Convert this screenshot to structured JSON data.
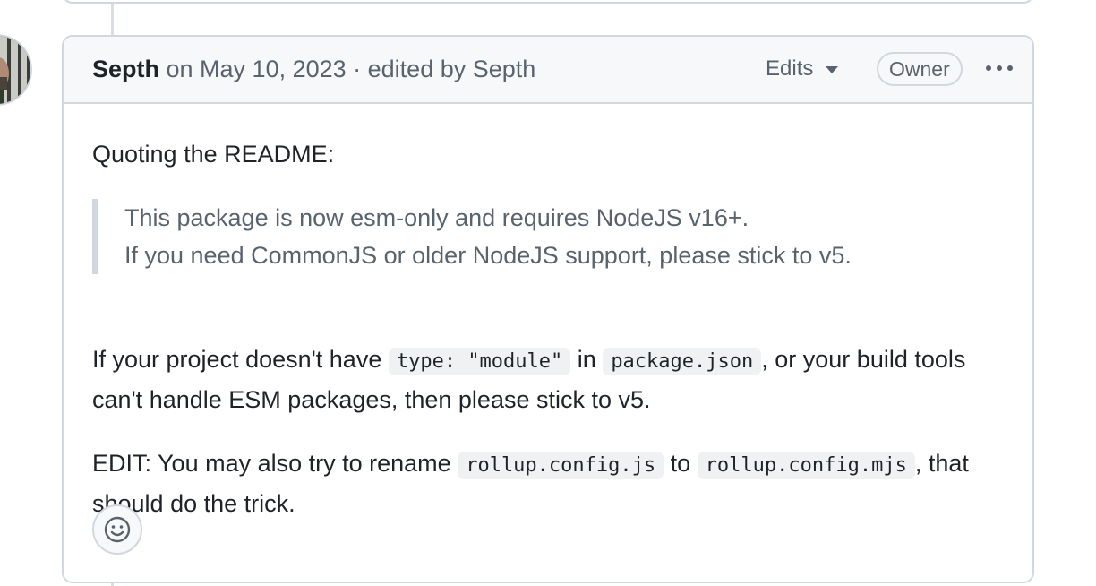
{
  "comment": {
    "author": "Septh",
    "date_text": " on May 10, 2023 · edited by ",
    "editor": "Septh",
    "edits_label": "Edits",
    "owner_badge": "Owner",
    "more_icon": "kebab-horizontal-icon",
    "body": {
      "p1": "Quoting the README:",
      "quote_line1": "This package is now esm-only and requires NodeJS v16+.",
      "quote_line2": "If you need CommonJS or older NodeJS support, please stick to v5.",
      "p2_text1": "If your project doesn't have ",
      "p2_code1": "type: \"module\"",
      "p2_text2": " in ",
      "p2_code2": "package.json",
      "p2_text3": ", or your build tools can't handle ESM packages, then please stick to v5.",
      "p3_text1": "EDIT: You may also try to rename ",
      "p3_code1": "rollup.config.js",
      "p3_text2": " to ",
      "p3_code2": "rollup.config.mjs",
      "p3_text3": ", that should do the trick."
    },
    "reaction_icon": "smiley-icon"
  },
  "colors": {
    "border": "#d0d7de",
    "header_bg": "#f6f8fa",
    "muted_text": "#59636e",
    "text": "#1f2328",
    "code_bg": "#eff1f3"
  }
}
